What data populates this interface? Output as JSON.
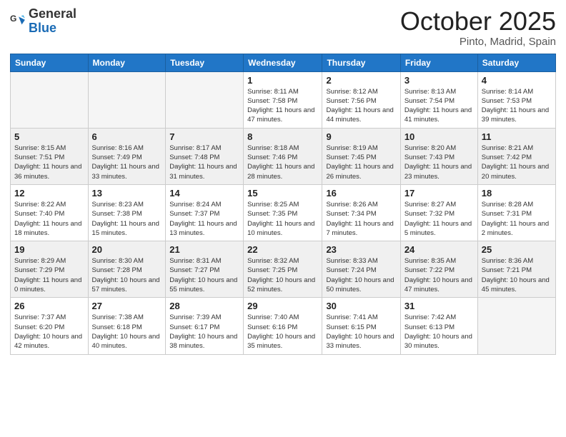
{
  "header": {
    "logo_general": "General",
    "logo_blue": "Blue",
    "title": "October 2025",
    "location": "Pinto, Madrid, Spain"
  },
  "weekdays": [
    "Sunday",
    "Monday",
    "Tuesday",
    "Wednesday",
    "Thursday",
    "Friday",
    "Saturday"
  ],
  "weeks": [
    [
      {
        "day": "",
        "info": ""
      },
      {
        "day": "",
        "info": ""
      },
      {
        "day": "",
        "info": ""
      },
      {
        "day": "1",
        "info": "Sunrise: 8:11 AM\nSunset: 7:58 PM\nDaylight: 11 hours and 47 minutes."
      },
      {
        "day": "2",
        "info": "Sunrise: 8:12 AM\nSunset: 7:56 PM\nDaylight: 11 hours and 44 minutes."
      },
      {
        "day": "3",
        "info": "Sunrise: 8:13 AM\nSunset: 7:54 PM\nDaylight: 11 hours and 41 minutes."
      },
      {
        "day": "4",
        "info": "Sunrise: 8:14 AM\nSunset: 7:53 PM\nDaylight: 11 hours and 39 minutes."
      }
    ],
    [
      {
        "day": "5",
        "info": "Sunrise: 8:15 AM\nSunset: 7:51 PM\nDaylight: 11 hours and 36 minutes."
      },
      {
        "day": "6",
        "info": "Sunrise: 8:16 AM\nSunset: 7:49 PM\nDaylight: 11 hours and 33 minutes."
      },
      {
        "day": "7",
        "info": "Sunrise: 8:17 AM\nSunset: 7:48 PM\nDaylight: 11 hours and 31 minutes."
      },
      {
        "day": "8",
        "info": "Sunrise: 8:18 AM\nSunset: 7:46 PM\nDaylight: 11 hours and 28 minutes."
      },
      {
        "day": "9",
        "info": "Sunrise: 8:19 AM\nSunset: 7:45 PM\nDaylight: 11 hours and 26 minutes."
      },
      {
        "day": "10",
        "info": "Sunrise: 8:20 AM\nSunset: 7:43 PM\nDaylight: 11 hours and 23 minutes."
      },
      {
        "day": "11",
        "info": "Sunrise: 8:21 AM\nSunset: 7:42 PM\nDaylight: 11 hours and 20 minutes."
      }
    ],
    [
      {
        "day": "12",
        "info": "Sunrise: 8:22 AM\nSunset: 7:40 PM\nDaylight: 11 hours and 18 minutes."
      },
      {
        "day": "13",
        "info": "Sunrise: 8:23 AM\nSunset: 7:38 PM\nDaylight: 11 hours and 15 minutes."
      },
      {
        "day": "14",
        "info": "Sunrise: 8:24 AM\nSunset: 7:37 PM\nDaylight: 11 hours and 13 minutes."
      },
      {
        "day": "15",
        "info": "Sunrise: 8:25 AM\nSunset: 7:35 PM\nDaylight: 11 hours and 10 minutes."
      },
      {
        "day": "16",
        "info": "Sunrise: 8:26 AM\nSunset: 7:34 PM\nDaylight: 11 hours and 7 minutes."
      },
      {
        "day": "17",
        "info": "Sunrise: 8:27 AM\nSunset: 7:32 PM\nDaylight: 11 hours and 5 minutes."
      },
      {
        "day": "18",
        "info": "Sunrise: 8:28 AM\nSunset: 7:31 PM\nDaylight: 11 hours and 2 minutes."
      }
    ],
    [
      {
        "day": "19",
        "info": "Sunrise: 8:29 AM\nSunset: 7:29 PM\nDaylight: 11 hours and 0 minutes."
      },
      {
        "day": "20",
        "info": "Sunrise: 8:30 AM\nSunset: 7:28 PM\nDaylight: 10 hours and 57 minutes."
      },
      {
        "day": "21",
        "info": "Sunrise: 8:31 AM\nSunset: 7:27 PM\nDaylight: 10 hours and 55 minutes."
      },
      {
        "day": "22",
        "info": "Sunrise: 8:32 AM\nSunset: 7:25 PM\nDaylight: 10 hours and 52 minutes."
      },
      {
        "day": "23",
        "info": "Sunrise: 8:33 AM\nSunset: 7:24 PM\nDaylight: 10 hours and 50 minutes."
      },
      {
        "day": "24",
        "info": "Sunrise: 8:35 AM\nSunset: 7:22 PM\nDaylight: 10 hours and 47 minutes."
      },
      {
        "day": "25",
        "info": "Sunrise: 8:36 AM\nSunset: 7:21 PM\nDaylight: 10 hours and 45 minutes."
      }
    ],
    [
      {
        "day": "26",
        "info": "Sunrise: 7:37 AM\nSunset: 6:20 PM\nDaylight: 10 hours and 42 minutes."
      },
      {
        "day": "27",
        "info": "Sunrise: 7:38 AM\nSunset: 6:18 PM\nDaylight: 10 hours and 40 minutes."
      },
      {
        "day": "28",
        "info": "Sunrise: 7:39 AM\nSunset: 6:17 PM\nDaylight: 10 hours and 38 minutes."
      },
      {
        "day": "29",
        "info": "Sunrise: 7:40 AM\nSunset: 6:16 PM\nDaylight: 10 hours and 35 minutes."
      },
      {
        "day": "30",
        "info": "Sunrise: 7:41 AM\nSunset: 6:15 PM\nDaylight: 10 hours and 33 minutes."
      },
      {
        "day": "31",
        "info": "Sunrise: 7:42 AM\nSunset: 6:13 PM\nDaylight: 10 hours and 30 minutes."
      },
      {
        "day": "",
        "info": ""
      }
    ]
  ],
  "row_backgrounds": [
    "#fff",
    "#ececec",
    "#fff",
    "#ececec",
    "#fff"
  ]
}
